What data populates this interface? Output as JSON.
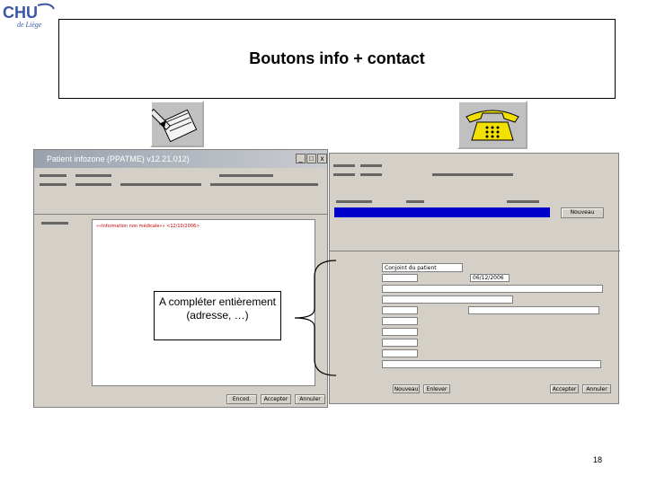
{
  "logo": {
    "text": "CHU",
    "subtitle": "de Liège"
  },
  "slide": {
    "title": "Boutons info + contact",
    "page_number": "18"
  },
  "icons": {
    "info": "notepad-pen-icon",
    "contact": "telephone-icon"
  },
  "left_window": {
    "title": "Patient infozone (PPATME) v12.21.012)",
    "controls": [
      "_",
      "□",
      "x"
    ],
    "info_line": "««Information non médicale»» <12/10/2006>",
    "buttons": [
      "Encod.",
      "Accepter",
      "Annuler"
    ]
  },
  "right_window": {
    "buttons_bottom_left": [
      "Nouveau",
      "Enlever"
    ],
    "buttons_bottom_right": [
      "Accepter",
      "Annuler"
    ],
    "new_contact_button": "Nouveau",
    "contact_type_value": "Conjoint du patient",
    "date_value": "06/12/2006"
  },
  "callout": {
    "text": "A compléter entièrement (adresse, …)"
  },
  "colors": {
    "selection": "#0000cc",
    "window_bg": "#d4d0c8",
    "logo_blue": "#3b57a7"
  }
}
